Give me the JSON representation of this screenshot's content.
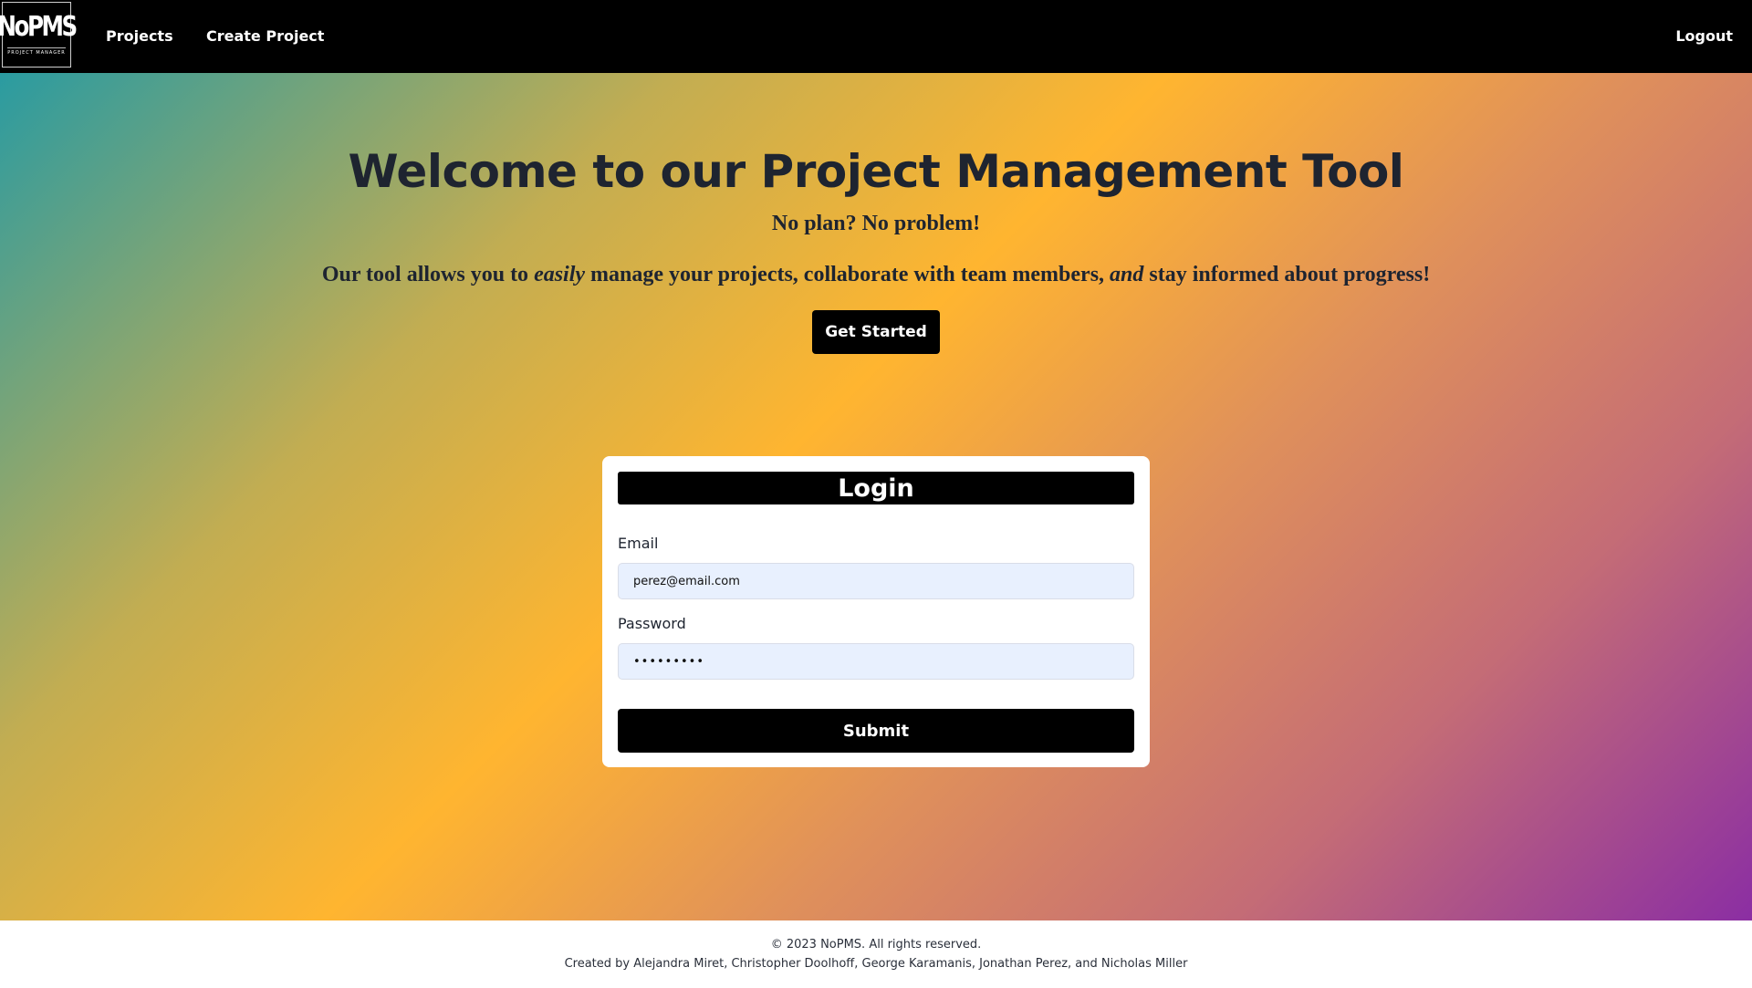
{
  "navbar": {
    "logo": {
      "word": "NoPMS",
      "subtitle": "PROJECT MANAGER"
    },
    "links": {
      "projects": "Projects",
      "create_project": "Create Project",
      "logout": "Logout"
    }
  },
  "hero": {
    "title": "Welcome to our Project Management Tool",
    "tagline": "No plan? No problem!",
    "description": {
      "part1": "Our tool allows you to ",
      "em1": "easily",
      "part2": " manage your projects, collaborate with team members, ",
      "em2": "and",
      "part3": " stay informed about progress!"
    },
    "cta_label": "Get Started"
  },
  "login": {
    "title": "Login",
    "email_label": "Email",
    "email_value": "perez@email.com",
    "password_label": "Password",
    "password_value": "password1",
    "submit_label": "Submit"
  },
  "footer": {
    "copyright": "© 2023 NoPMS. All rights reserved.",
    "credits": "Created by  Alejandra Miret, Christopher Doolhoff, George Karamanis, Jonathan Perez, and Nicholas Miller"
  },
  "colors": {
    "navbar_bg": "#000000",
    "text_dark": "#1e2430",
    "input_bg": "#e8f0fe",
    "gradient": [
      "#2a9ba1",
      "#ffb530",
      "#8b2ea3"
    ]
  }
}
